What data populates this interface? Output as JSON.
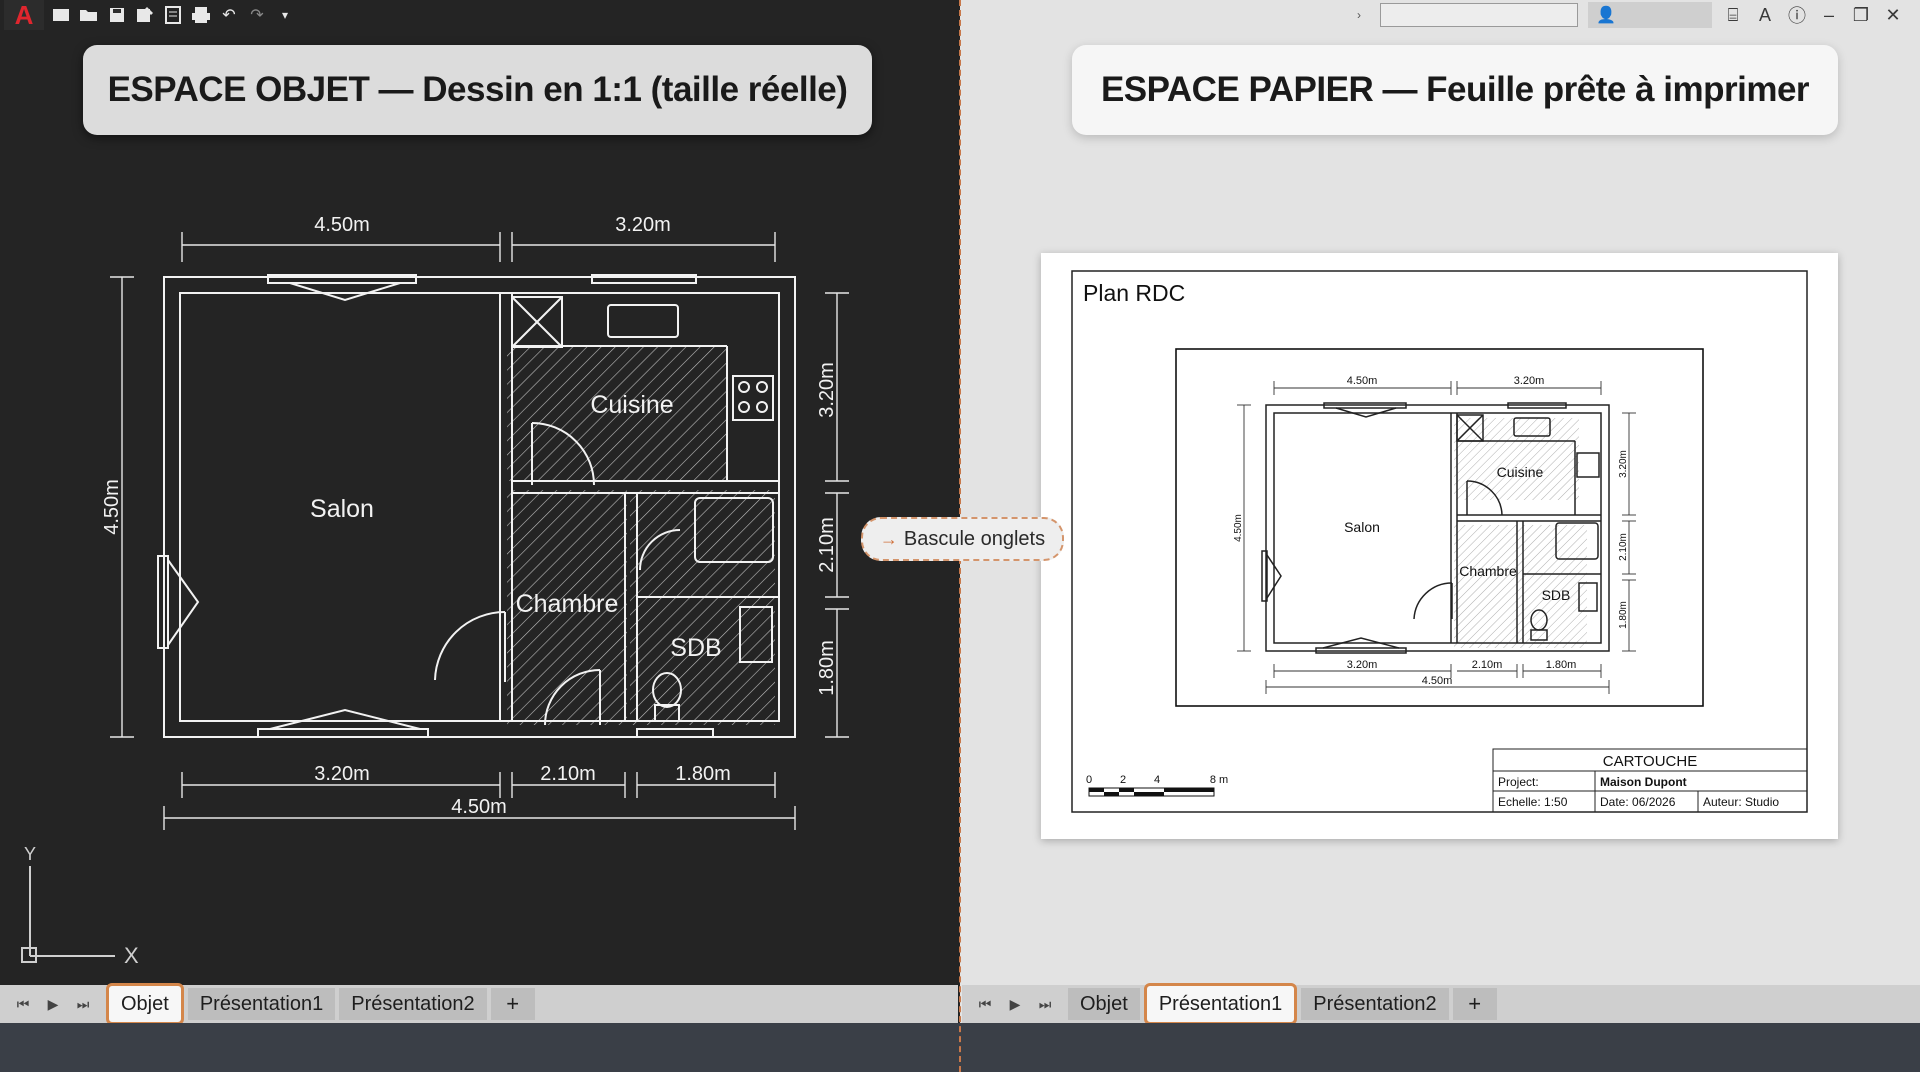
{
  "toolbar": {
    "app_logo": "A",
    "icons": [
      "new-icon",
      "open-icon",
      "save-icon",
      "save-as-icon",
      "publish-icon",
      "plot-icon",
      "undo-icon",
      "redo-icon",
      "customize-icon"
    ]
  },
  "left_title": "ESPACE OBJET — Dessin en 1:1 (taille réelle)",
  "right_title": "ESPACE PAPIER  — Feuille prête à imprimer",
  "bascule_label": "Bascule onglets",
  "model_plan": {
    "rooms": {
      "salon": "Salon",
      "cuisine": "Cuisine",
      "chambre": "Chambre",
      "sdb": "SDB"
    },
    "dims": {
      "top_a": "4.50m",
      "top_b": "3.20m",
      "bottom_a": "3.20m",
      "bottom_b": "2.10m",
      "bottom_c": "1.80m",
      "bottom_total": "4.50m",
      "left": "4.50m",
      "right_a": "3.20m",
      "right_b": "2.10m",
      "right_c": "1.80m"
    }
  },
  "ucs": {
    "x": "X",
    "y": "Y"
  },
  "left_tabs": [
    "Objet",
    "Présentation1",
    "Présentation2",
    "+"
  ],
  "right_tabs": [
    "Objet",
    "Présentation1",
    "Présentation2",
    "+"
  ],
  "paper": {
    "title": "Plan RDC",
    "rooms": {
      "salon": "Salon",
      "cuisine": "Cuisine",
      "chambre": "Chambre",
      "sdb": "SDB"
    },
    "dims": {
      "top_a": "4.50m",
      "top_b": "3.20m",
      "bottom_a": "3.20m",
      "bottom_b": "2.10m",
      "bottom_c": "1.80m",
      "bottom_total": "4.50m",
      "left": "4.50m",
      "right_a": "3.20m",
      "right_b": "2.10m",
      "right_c": "1.80m"
    },
    "scale_bar": {
      "labels": [
        "0",
        "2",
        "4",
        "8 m"
      ]
    },
    "cartouche": {
      "title": "CARTOUCHE",
      "project_label": "Project:",
      "project_value": "Maison Dupont",
      "scale": "Echelle: 1:50",
      "date": "Date: 06/2026",
      "author": "Auteur: Studio"
    }
  },
  "colors": {
    "accent": "#d4864a",
    "model_bg": "#242424",
    "paper_bg": "#e3e3e3"
  }
}
